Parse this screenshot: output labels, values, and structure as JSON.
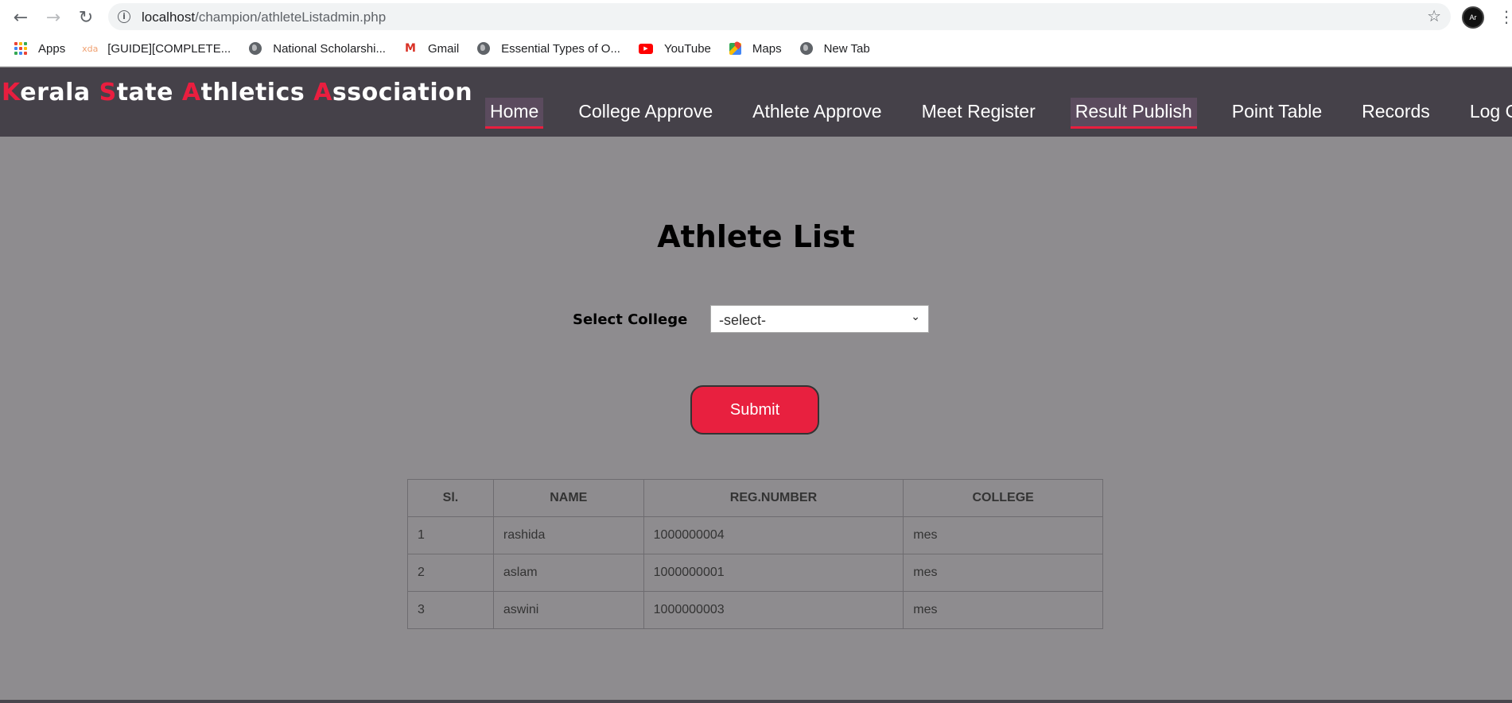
{
  "browser": {
    "url_host": "localhost",
    "url_path": "/champion/athleteListadmin.php",
    "profile_initials": "Ar",
    "bookmarks": [
      {
        "label": "Apps",
        "icon": "apps-grid-icon"
      },
      {
        "label": "[GUIDE][COMPLETE...",
        "icon": "xda-icon",
        "icon_text": "xda"
      },
      {
        "label": "National Scholarshi...",
        "icon": "globe-icon"
      },
      {
        "label": "Gmail",
        "icon": "gmail-icon",
        "icon_text": "M"
      },
      {
        "label": "Essential Types of O...",
        "icon": "globe-icon"
      },
      {
        "label": "YouTube",
        "icon": "youtube-icon"
      },
      {
        "label": "Maps",
        "icon": "maps-icon"
      },
      {
        "label": "New Tab",
        "icon": "globe-icon"
      }
    ]
  },
  "site": {
    "logo": {
      "parts": [
        {
          "cap": "K",
          "rest": "erala "
        },
        {
          "cap": "S",
          "rest": "tate "
        },
        {
          "cap": "A",
          "rest": "thletics "
        },
        {
          "cap": "A",
          "rest": "ssociation"
        }
      ]
    },
    "menu": [
      {
        "label": "Home",
        "active": true
      },
      {
        "label": "College Approve",
        "active": false
      },
      {
        "label": "Athlete Approve",
        "active": false
      },
      {
        "label": "Meet Register",
        "active": false
      },
      {
        "label": "Result Publish",
        "active": true
      },
      {
        "label": "Point Table",
        "active": false
      },
      {
        "label": "Records",
        "active": false
      },
      {
        "label": "Log Out",
        "active": false
      }
    ]
  },
  "main": {
    "title": "Athlete List",
    "select_label": "Select College",
    "select_value": "-select-",
    "submit_label": "Submit",
    "table": {
      "headers": [
        "Sl.",
        "NAME",
        "REG.NUMBER",
        "COLLEGE"
      ],
      "rows": [
        [
          "1",
          "rashida",
          "1000000004",
          "mes"
        ],
        [
          "2",
          "aslam",
          "1000000001",
          "mes"
        ],
        [
          "3",
          "aswini",
          "1000000003",
          "mes"
        ]
      ]
    }
  },
  "colors": {
    "accent": "#e91e3f",
    "header_bg": "#454149",
    "content_bg": "#8e8c8f",
    "submit_bg": "#e8203f"
  }
}
